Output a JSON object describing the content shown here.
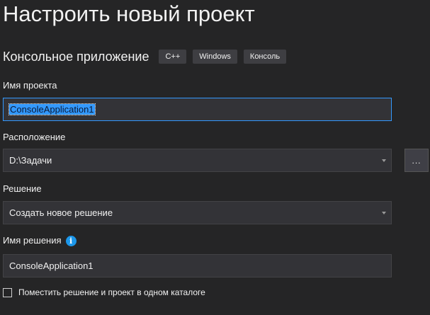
{
  "header": {
    "title": "Настроить новый проект"
  },
  "template": {
    "name": "Консольное приложение",
    "tags": [
      "C++",
      "Windows",
      "Консоль"
    ]
  },
  "form": {
    "project_name": {
      "label": "Имя проекта",
      "value": "ConsoleApplication1"
    },
    "location": {
      "label": "Расположение",
      "value": "D:\\Задачи",
      "browse_label": "..."
    },
    "solution": {
      "label": "Решение",
      "value": "Создать новое решение"
    },
    "solution_name": {
      "label": "Имя решения",
      "value": "ConsoleApplication1",
      "info_icon": "i"
    },
    "same_directory": {
      "label": "Поместить решение и проект в одном каталоге",
      "checked": false
    }
  },
  "colors": {
    "background": "#252526",
    "field_background": "#333337",
    "focus_border": "#3399ff",
    "info_accent": "#1c97ea",
    "tag_background": "#3e3e42"
  }
}
